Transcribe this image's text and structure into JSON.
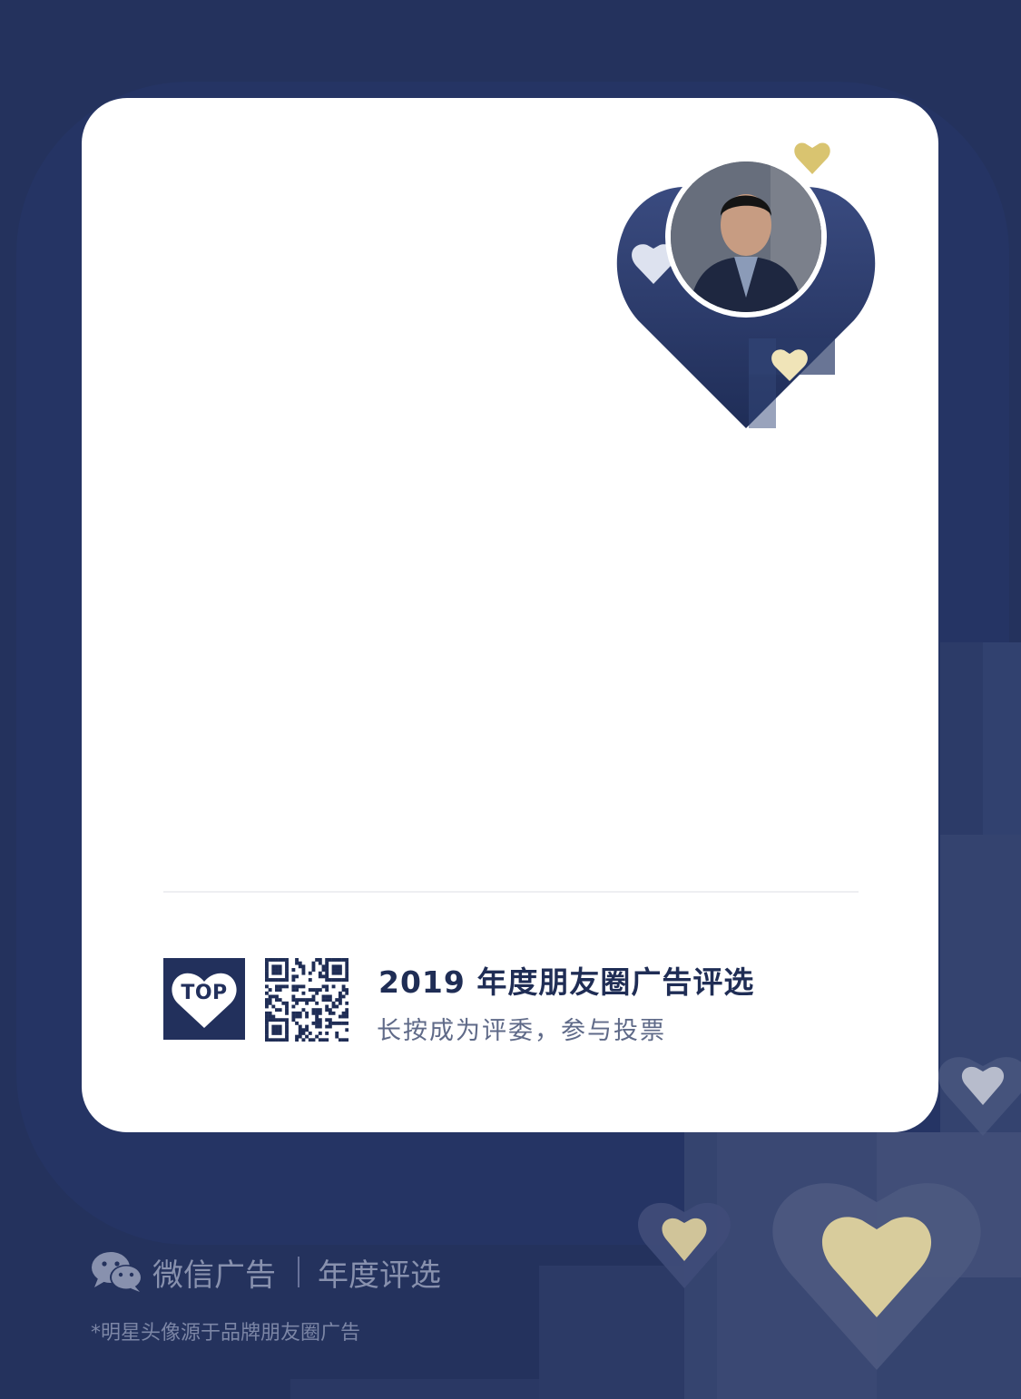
{
  "colors": {
    "background": "#24325d",
    "card": "#ffffff",
    "navy": "#22305c",
    "gold": "#d9c470",
    "cream": "#e8dcb0"
  },
  "card": {
    "title": "2019 年度朋友圈广告评选",
    "subtitle": "长按成为评委，参与投票",
    "logo_text": "TOP",
    "icons": {
      "logo": "top-heart-logo",
      "qr": "qr-code",
      "avatar": "celebrity-avatar",
      "badge": "heart-badge"
    }
  },
  "footer": {
    "brand": "微信广告",
    "section": "年度评选",
    "note": "*明星头像源于品牌朋友圈广告",
    "brand_icon": "wechat-icon"
  }
}
